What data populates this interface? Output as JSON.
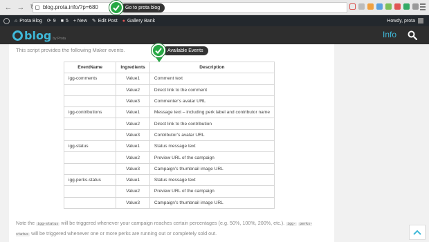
{
  "browser": {
    "url": "blog.prota.info/?p=680",
    "colors": {
      "ext1": "#d9534f",
      "ext2": "#bbbbbb",
      "ext3": "#f0a040",
      "ext4": "#5aa0e0",
      "ext5": "#7cbf5a",
      "ext6": "#e05555",
      "ext7": "#33aa66",
      "ext8": "#999999"
    }
  },
  "admin_bar": {
    "site_name": "Prota Blog",
    "updates_count": "9",
    "comments_count": "5",
    "new_label": "+ New",
    "edit_label": "Edit Post",
    "gallery_label": "Gallery Bank",
    "howdy": "Howdy, prota"
  },
  "site": {
    "logo_text": "blog",
    "logo_sub": "by Prota",
    "nav_info": "Info",
    "accent": "#3fb8d8"
  },
  "article": {
    "intro": "This script provides the following Maker events.",
    "table": {
      "headers": [
        "EventName",
        "Ingredients",
        "Description"
      ],
      "rows": [
        [
          "igg-comments",
          "Value1",
          "Comment text"
        ],
        [
          "",
          "Value2",
          "Direct link to the comment"
        ],
        [
          "",
          "Value3",
          "Commenter’s avatar URL"
        ],
        [
          "igg-contributions",
          "Value1",
          "Message text – including perk label and contributor name"
        ],
        [
          "",
          "Value2",
          "Direct link to the contribution"
        ],
        [
          "",
          "Value3",
          "Contributor’s avatar URL"
        ],
        [
          "igg-status",
          "Value1",
          "Status message text"
        ],
        [
          "",
          "Value2",
          "Preview URL of the campaign"
        ],
        [
          "",
          "Value3",
          "Campaign’s thumbnail image URL"
        ],
        [
          "igg-perks-status",
          "Value1",
          "Status message text"
        ],
        [
          "",
          "Value2",
          "Preview URL of the campaign"
        ],
        [
          "",
          "Value3",
          "Campaign’s thumbnail image URL"
        ]
      ]
    },
    "footnote": {
      "prefix": "Note the",
      "code1": "igg-status",
      "mid": "will be triggered whenever your campaign reaches certain percentages (e.g. 50%, 100%, 200%, etc.).",
      "code2a": "igg-",
      "code2b": "perks-status",
      "suffix": "will be triggered whenever one or more perks are running out or completely sold out."
    }
  },
  "tooltips": {
    "top": "Go to prota blog",
    "events": "Available Events"
  }
}
